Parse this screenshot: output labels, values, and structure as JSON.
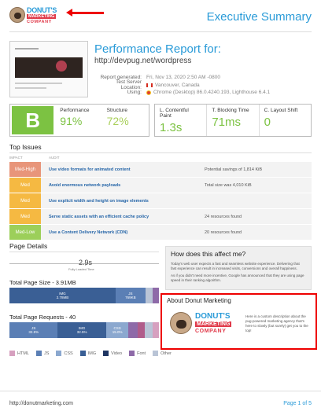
{
  "header": {
    "logo": {
      "line1": "DONUT'S",
      "line2": "MARKETING",
      "line3": "COMPANY"
    },
    "title": "Executive Summary"
  },
  "report": {
    "title": "Performance Report for:",
    "url": "http://devpug.net/wordpress",
    "meta": [
      {
        "key": "Report generated:",
        "value": "Fri, Nov 13, 2020 2:50 AM -0800"
      },
      {
        "key": "Test Server Location:",
        "value": "Vancouver, Canada"
      },
      {
        "key": "Using:",
        "value": "Chrome (Desktop) 86.0.4240.193, Lighthouse 6.4.1"
      }
    ]
  },
  "scores": {
    "grade": "B",
    "grade_color": "#7cc242",
    "performance": {
      "label": "Performance",
      "value": "91%"
    },
    "structure": {
      "label": "Structure",
      "value": "72%"
    },
    "vitals": [
      {
        "label": "L. Contentful Paint",
        "value": "1.3s"
      },
      {
        "label": "T. Blocking Time",
        "value": "71ms"
      },
      {
        "label": "C. Layout Shift",
        "value": "0"
      }
    ]
  },
  "top_issues": {
    "heading": "Top Issues",
    "col_impact": "IMPACT",
    "col_audit": "AUDIT",
    "items": [
      {
        "impact": "Med-High",
        "color": "#e8957a",
        "audit": "Use video formats for animated content",
        "detail": "Potential savings of 1,814 KiB"
      },
      {
        "impact": "Med",
        "color": "#f5b942",
        "audit": "Avoid enormous network payloads",
        "detail": "Total size was 4,010 KiB"
      },
      {
        "impact": "Med",
        "color": "#f5b942",
        "audit": "Use explicit width and height on image elements",
        "detail": ""
      },
      {
        "impact": "Med",
        "color": "#f5b942",
        "audit": "Serve static assets with an efficient cache policy",
        "detail": "24 resources found"
      },
      {
        "impact": "Med-Low",
        "color": "#9ccf5a",
        "audit": "Use a Content Delivery Network (CDN)",
        "detail": "20 resources found"
      }
    ]
  },
  "page_details": {
    "heading": "Page Details",
    "load_time": "2.9s",
    "load_label": "Fully Loaded Time",
    "size_heading": "Total Page Size - 3.91MB",
    "size_segments": [
      {
        "name": "IMG",
        "value": "2.78MB",
        "fraction": 0.71,
        "color": "#3a5f95"
      },
      {
        "name": "JS",
        "value": "769KB",
        "fraction": 0.2,
        "color": "#5b7fb5"
      },
      {
        "name": "",
        "value": "",
        "fraction": 0.05,
        "color": "#b9c4d6"
      },
      {
        "name": "",
        "value": "",
        "fraction": 0.04,
        "color": "#8e6aa8"
      }
    ],
    "requests_heading": "Total Page Requests - 40",
    "request_segments": [
      {
        "name": "JS",
        "value": "32.5%",
        "fraction": 0.325,
        "color": "#5b7fb5"
      },
      {
        "name": "IMG",
        "value": "32.5%",
        "fraction": 0.325,
        "color": "#3a5f95"
      },
      {
        "name": "CSS",
        "value": "15.0%",
        "fraction": 0.15,
        "color": "#8ba8cf"
      },
      {
        "name": "",
        "value": "",
        "fraction": 0.06,
        "color": "#8e6aa8"
      },
      {
        "name": "",
        "value": "",
        "fraction": 0.05,
        "color": "#b05c8a"
      },
      {
        "name": "",
        "value": "",
        "fraction": 0.05,
        "color": "#b9c4d6"
      },
      {
        "name": "",
        "value": "",
        "fraction": 0.045,
        "color": "#d6a0bf"
      }
    ],
    "legend": [
      {
        "label": "HTML",
        "color": "#d6a0bf"
      },
      {
        "label": "JS",
        "color": "#5b7fb5"
      },
      {
        "label": "CSS",
        "color": "#8ba8cf"
      },
      {
        "label": "IMG",
        "color": "#3a5f95"
      },
      {
        "label": "Video",
        "color": "#1e3562"
      },
      {
        "label": "Font",
        "color": "#8e6aa8"
      },
      {
        "label": "Other",
        "color": "#b9c4d6"
      }
    ]
  },
  "affect": {
    "heading": "How does this affect me?",
    "p1": "Today's web user expects a fast and seamless website experience. Delivering that fast experience can result in increased visits, conversions and overall happiness.",
    "p2": "As if you didn't need more incentive, Google has announced that they are using page speed in their ranking algorithm."
  },
  "about": {
    "heading": "About Donut Marketing",
    "logo": {
      "line1": "DONUT'S",
      "line2": "MARKETING",
      "line3": "COMPANY"
    },
    "text": "Here is a custom description about the pug-powered marketing agency that's here to slowly (but surely) get you to the top!"
  },
  "footer": {
    "url": "http://donutmarketing.com",
    "page": "Page 1 of 5"
  }
}
